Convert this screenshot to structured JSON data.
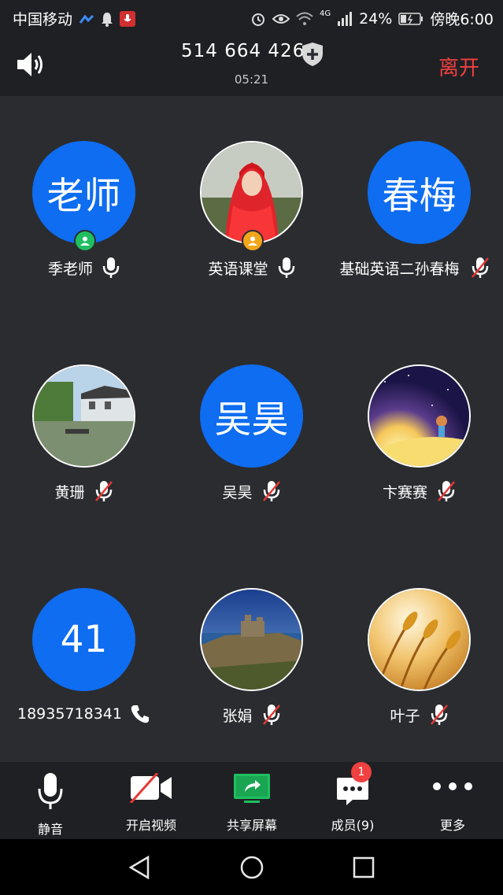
{
  "status_bar": {
    "carrier": "中国移动",
    "network": "4G",
    "battery": "24%",
    "time": "傍晚6:00"
  },
  "header": {
    "meeting_id": "514 664 426",
    "elapsed": "05:21",
    "leave_label": "离开"
  },
  "participants": [
    {
      "name": "季老师",
      "avatar_text": "老师",
      "avatar_type": "text",
      "mic": "on",
      "badge": "host",
      "badge_color": "#1fbf5f"
    },
    {
      "name": "英语课堂",
      "avatar_text": "",
      "avatar_type": "photo-red-veil",
      "mic": "on",
      "badge": "cohost",
      "badge_color": "#f2a61b"
    },
    {
      "name": "基础英语二孙春梅",
      "avatar_text": "春梅",
      "avatar_type": "text",
      "mic": "muted",
      "badge": ""
    },
    {
      "name": "黄珊",
      "avatar_text": "",
      "avatar_type": "photo-water-town",
      "mic": "muted",
      "badge": ""
    },
    {
      "name": "吴昊",
      "avatar_text": "吴昊",
      "avatar_type": "text",
      "mic": "muted",
      "badge": ""
    },
    {
      "name": "卞赛赛",
      "avatar_text": "",
      "avatar_type": "photo-night-moon",
      "mic": "muted",
      "badge": ""
    },
    {
      "name": "18935718341",
      "avatar_text": "41",
      "avatar_type": "text",
      "mic": "phone",
      "badge": ""
    },
    {
      "name": "张娟",
      "avatar_text": "",
      "avatar_type": "photo-castle",
      "mic": "muted",
      "badge": ""
    },
    {
      "name": "叶子",
      "avatar_text": "",
      "avatar_type": "photo-wheat",
      "mic": "muted",
      "badge": ""
    }
  ],
  "toolbar": {
    "mute_label": "静音",
    "video_label": "开启视频",
    "share_label": "共享屏幕",
    "members_label": "成员(9)",
    "members_badge": "1",
    "more_label": "更多"
  },
  "colors": {
    "accent_blue": "#0e6df0",
    "leave_red": "#f04040",
    "mute_red": "#e53935",
    "share_green": "#1fbf5f"
  },
  "icons": [
    "speaker-icon",
    "shield-plus-icon",
    "mic-icon",
    "mic-muted-icon",
    "phone-icon",
    "video-off-icon",
    "share-screen-icon",
    "members-icon",
    "more-icon"
  ]
}
